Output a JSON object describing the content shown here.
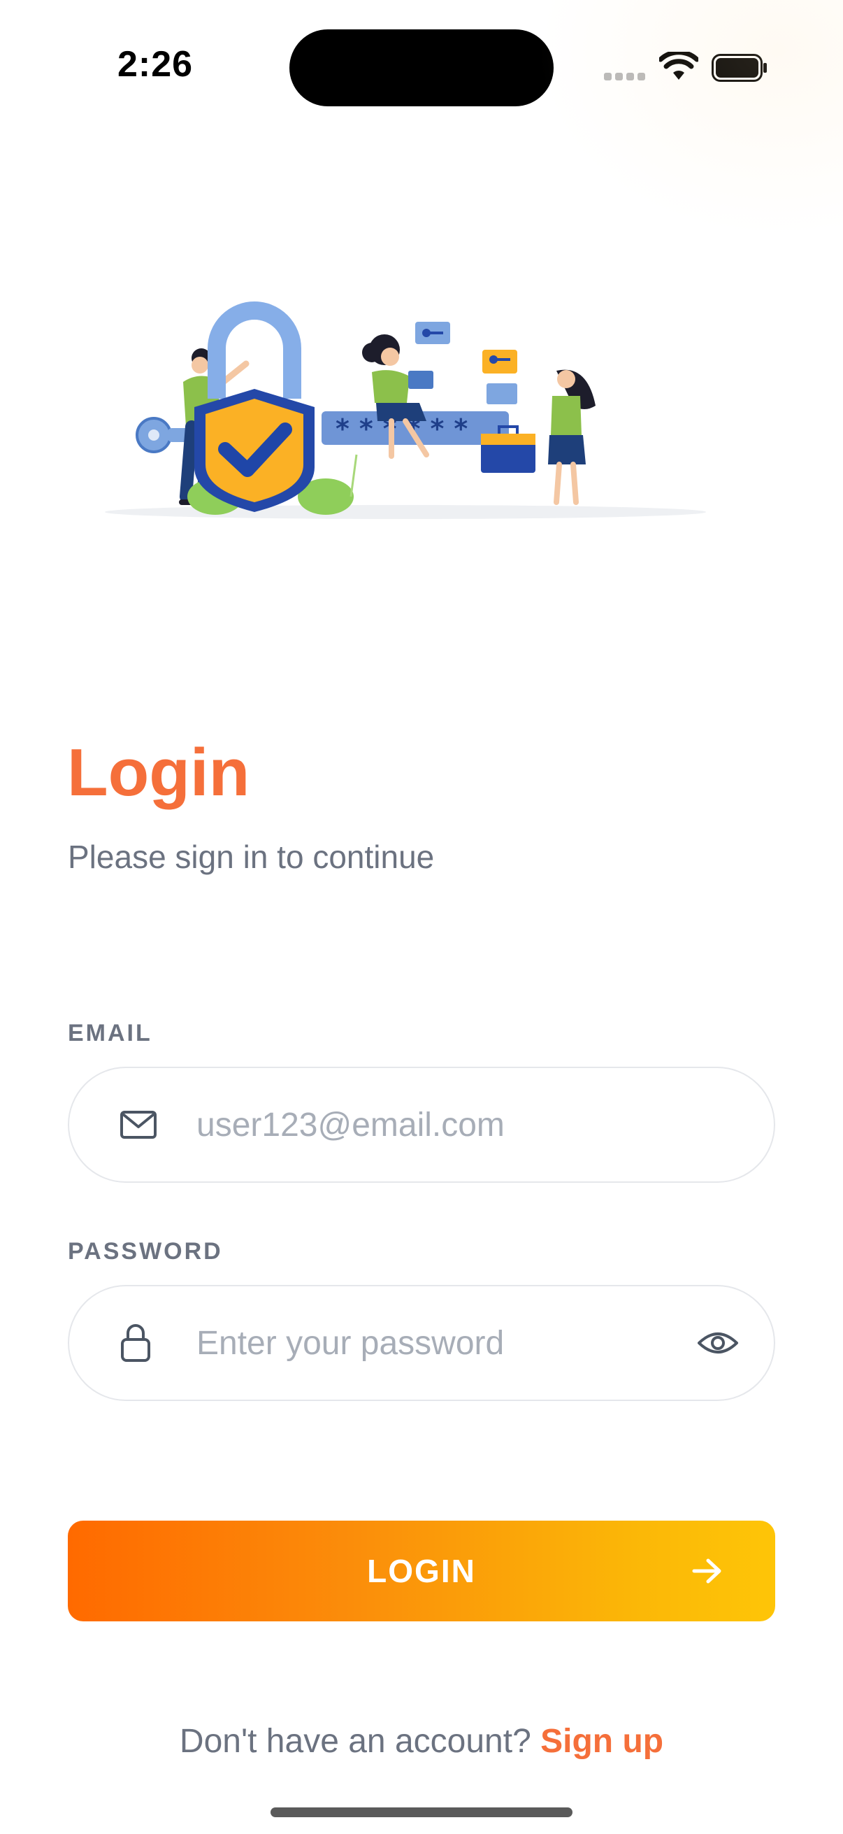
{
  "status_bar": {
    "time": "2:26"
  },
  "login": {
    "title": "Login",
    "subtitle": "Please sign in to continue",
    "email_label": "EMAIL",
    "email_placeholder": "user123@email.com",
    "password_label": "PASSWORD",
    "password_placeholder": "Enter your password",
    "button_label": "LOGIN",
    "signup_prompt": "Don't have an account?",
    "signup_link": "Sign up"
  },
  "icons": {
    "email": "mail-icon",
    "password": "lock-icon",
    "toggle_visibility": "eye-icon",
    "button": "arrow-right-icon"
  },
  "colors": {
    "accent": "#f56f3a",
    "button_gradient_start": "#ff6a00",
    "button_gradient_end": "#fec507",
    "muted_text": "#6b7280"
  }
}
